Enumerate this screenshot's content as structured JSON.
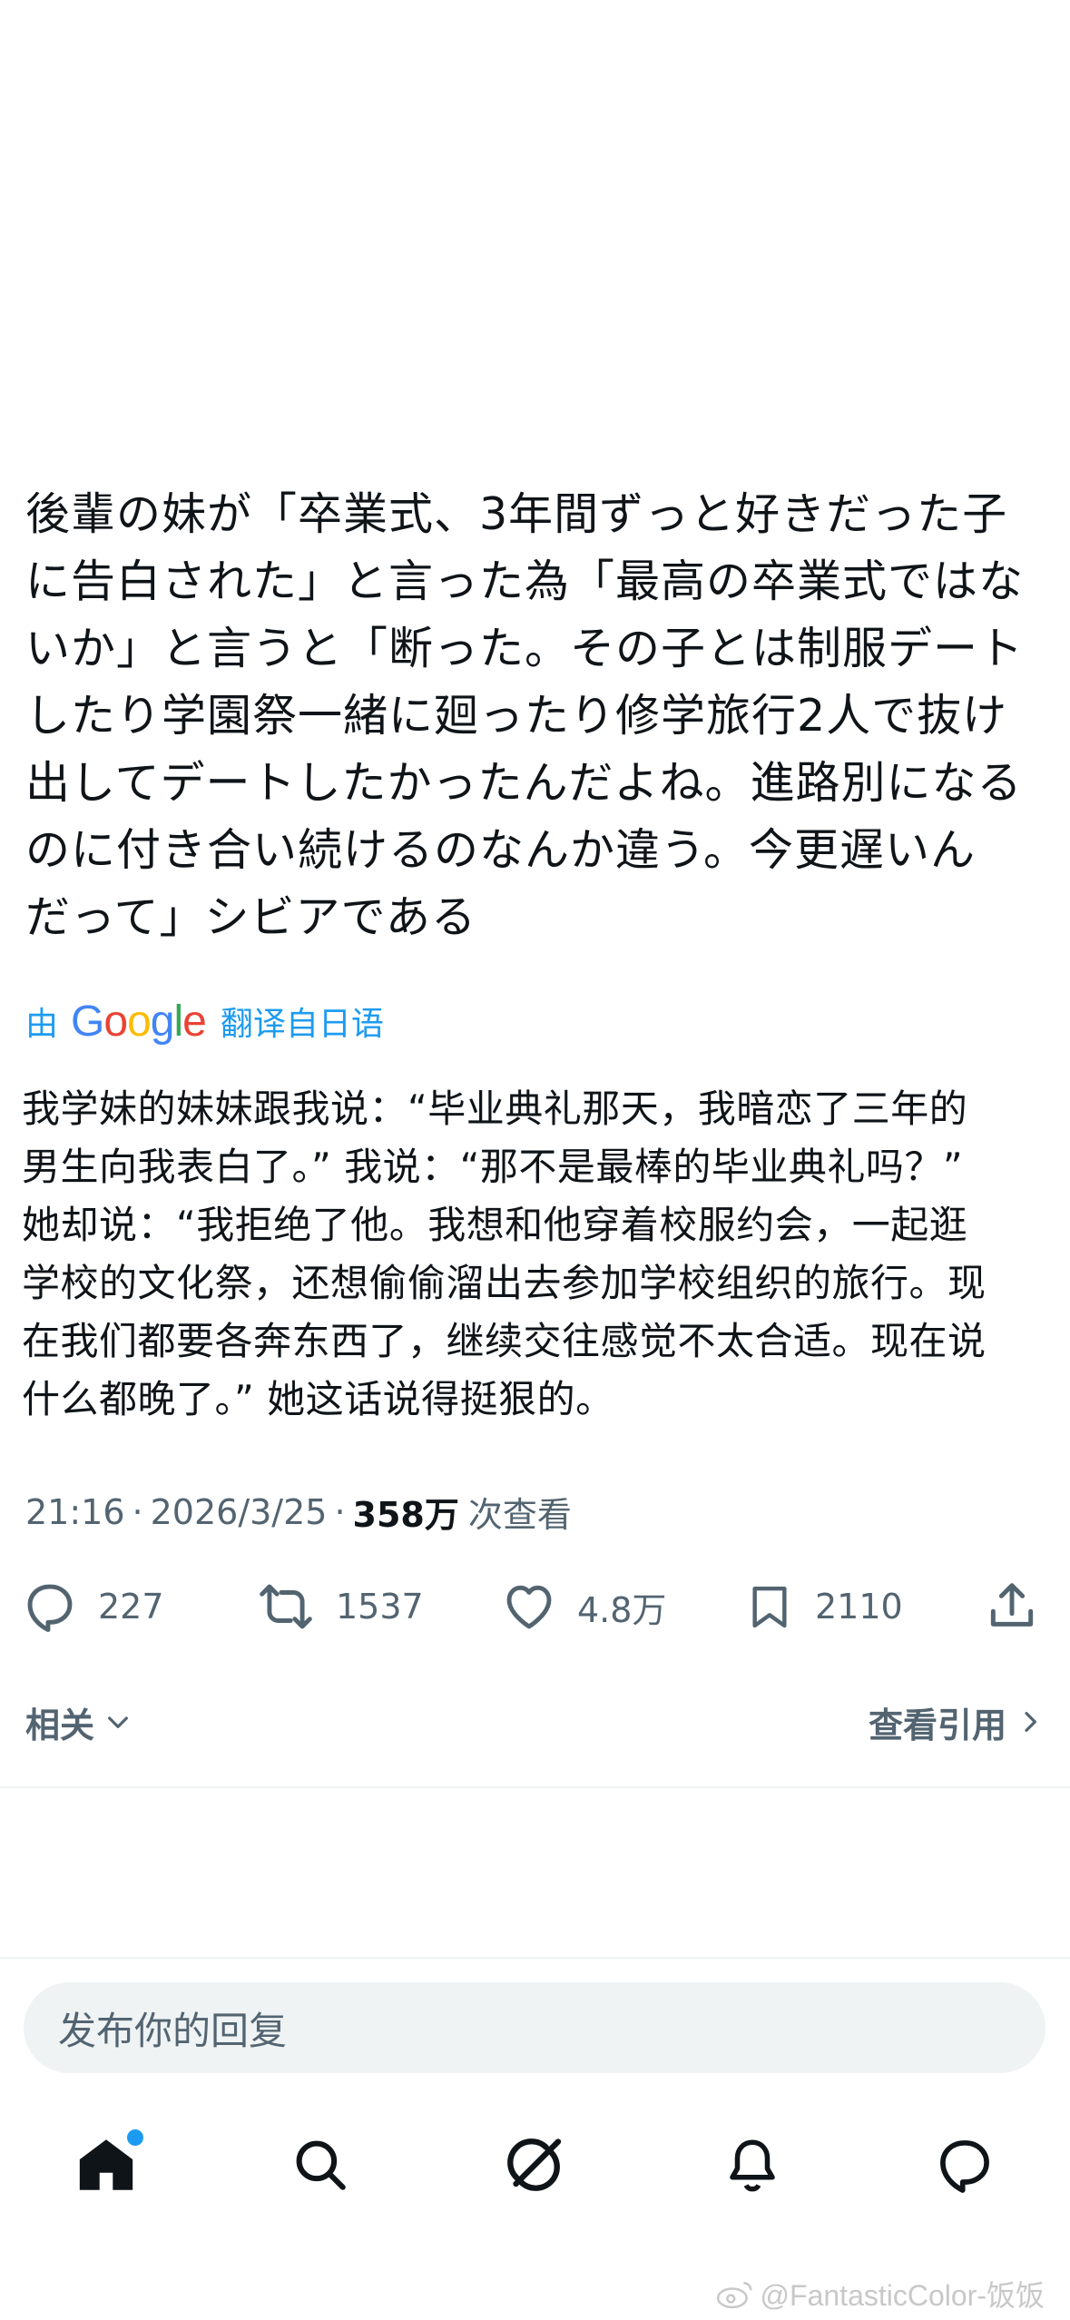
{
  "tweet": {
    "text": "後輩の妹が「卒業式、3年間ずっと好きだった子\nに告白された」と言った為「最高の卒業式ではな\nいか」と言うと「断った。その子とは制服デート\nしたり学園祭一緒に廻ったり修学旅行2人で抜け\n出してデートしたかったんだよね。進路別になる\nのに付き合い続けるのなんか違う。今更遅いん\nだって」シビアである"
  },
  "translation": {
    "prefix": "由",
    "brand": [
      "G",
      "o",
      "o",
      "g",
      "l",
      "e"
    ],
    "brand_colors": [
      "#4285F4",
      "#EA4335",
      "#FBBC05",
      "#4285F4",
      "#34A853",
      "#EA4335"
    ],
    "suffix": "翻译自日语",
    "text": "我学妹的妹妹跟我说：“毕业典礼那天，我暗恋了三年的\n男生向我表白了。” 我说：“那不是最棒的毕业典礼吗？”\n她却说：“我拒绝了他。我想和他穿着校服约会，一起逛\n学校的文化祭，还想偷偷溜出去参加学校组织的旅行。现\n在我们都要各奔东西了，继续交往感觉不太合适。现在说\n什么都晚了。” 她这话说得挺狠的。"
  },
  "meta": {
    "time": "21:16",
    "separator": "·",
    "date": "2026/3/25",
    "views": "358万",
    "views_label": "次查看"
  },
  "actions": {
    "replies": "227",
    "retweets": "1537",
    "likes": "4.8万",
    "bookmarks": "2110"
  },
  "related": {
    "label": "相关",
    "quotes_label": "查看引用"
  },
  "reply": {
    "placeholder": "发布你的回复"
  },
  "nav": {
    "icons": [
      "home-icon",
      "search-icon",
      "grok-icon",
      "bell-icon",
      "messages-icon"
    ]
  },
  "colors": {
    "text": "#0f1419",
    "secondary": "#536471",
    "accent": "#1d9bf0",
    "divider": "#eff3f4"
  },
  "watermark": {
    "text": "@FantasticColor-饭饭"
  }
}
